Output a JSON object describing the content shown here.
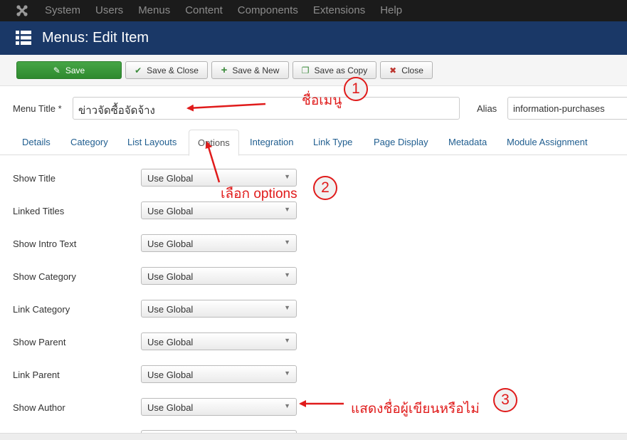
{
  "topnav": {
    "logo_icon": "joomla-logo-icon",
    "items": [
      "System",
      "Users",
      "Menus",
      "Content",
      "Components",
      "Extensions",
      "Help"
    ]
  },
  "titlebar": {
    "icon": "list-menu-icon",
    "title": "Menus: Edit Item"
  },
  "toolbar": {
    "save": "Save",
    "save_close": "Save & Close",
    "save_new": "Save & New",
    "save_copy": "Save as Copy",
    "close": "Close"
  },
  "form": {
    "menu_title_label": "Menu Title *",
    "menu_title_value": "ข่าวจัดซื้อจัดจ้าง",
    "alias_label": "Alias",
    "alias_value": "information-purchases"
  },
  "tabs": [
    "Details",
    "Category",
    "List Layouts",
    "Options",
    "Integration",
    "Link Type",
    "Page Display",
    "Metadata",
    "Module Assignment"
  ],
  "active_tab": "Options",
  "options": [
    {
      "label": "Show Title",
      "value": "Use Global"
    },
    {
      "label": "Linked Titles",
      "value": "Use Global"
    },
    {
      "label": "Show Intro Text",
      "value": "Use Global"
    },
    {
      "label": "Show Category",
      "value": "Use Global"
    },
    {
      "label": "Link Category",
      "value": "Use Global"
    },
    {
      "label": "Show Parent",
      "value": "Use Global"
    },
    {
      "label": "Link Parent",
      "value": "Use Global"
    },
    {
      "label": "Show Author",
      "value": "Use Global"
    }
  ],
  "annotations": {
    "a1_text": "ชื่อเมนู",
    "a1_num": "1",
    "a2_text": "เลือก options",
    "a2_num": "2",
    "a3_text": "แสดงชื่อผู้เขียนหรือไม่",
    "a3_num": "3",
    "color": "#e01b1b"
  },
  "colors": {
    "topnav_bg": "#1b1b1b",
    "titlebar_bg": "#1a3867",
    "save_green": "#3b973b",
    "link_blue": "#1f5d8f"
  }
}
